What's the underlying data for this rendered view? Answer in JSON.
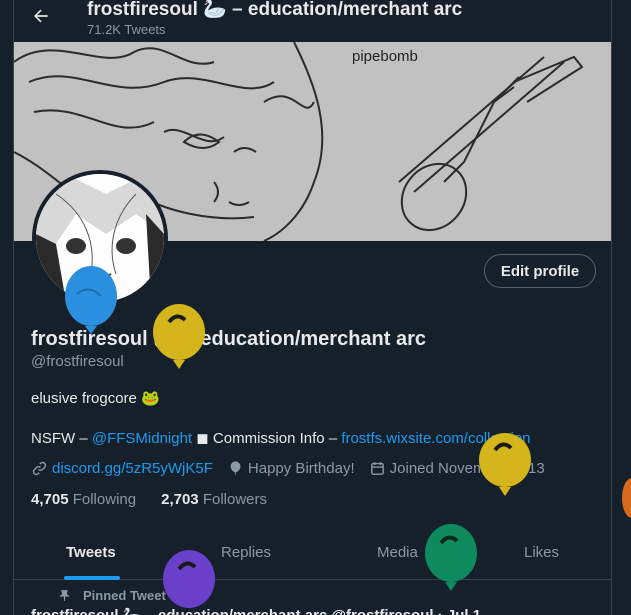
{
  "header": {
    "title": "frostfiresoul 🦢 – education/merchant arc",
    "tweet_count": "71.2K Tweets"
  },
  "banner": {
    "text": "pipebomb"
  },
  "profile": {
    "edit_label": "Edit profile",
    "name": "frostfiresoul 🦢 – education/merchant arc",
    "handle": "@frostfiresoul",
    "bio": "elusive frogcore 🐸",
    "bio_nsfw_prefix": "NSFW – ",
    "bio_nsfw_link": "@FFSMidnight",
    "bio_square": "◼",
    "bio_commission_prefix": " Commission Info – ",
    "bio_commission_link": "frostfs.wixsite.com/collection",
    "website": "discord.gg/5zR5yWjK5F",
    "birthday": "Happy Birthday!",
    "joined": "Joined November 2013",
    "following_count": "4,705",
    "following_label": "Following",
    "followers_count": "2,703",
    "followers_label": "Followers"
  },
  "tabs": [
    {
      "label": "Tweets"
    },
    {
      "label": "Replies"
    },
    {
      "label": "Media"
    },
    {
      "label": "Likes"
    }
  ],
  "pinned": {
    "label": "Pinned Tweet",
    "preview": "frostfiresoul 🦢 – education/merchant arc  @frostfiresoul · Jul 1"
  },
  "colors": {
    "background": "#15202b",
    "accent": "#1d9bf0",
    "muted": "#8b98a5",
    "balloon_blue": "#2a8fde",
    "balloon_yellow": "#d4b51b",
    "balloon_green": "#0f8a5f",
    "balloon_purple": "#6a3fc9"
  }
}
